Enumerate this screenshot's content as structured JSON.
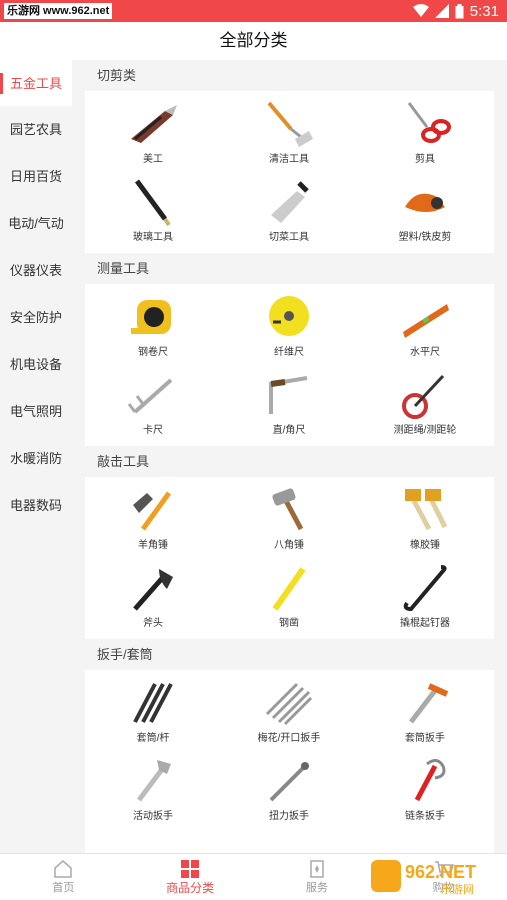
{
  "status": {
    "watermark_left": "乐游网 www.962.net",
    "time": "5:31"
  },
  "header": {
    "title": "全部分类"
  },
  "sidebar": {
    "items": [
      {
        "label": "五金工具",
        "active": true
      },
      {
        "label": "园艺农具"
      },
      {
        "label": "日用百货"
      },
      {
        "label": "电动/气动"
      },
      {
        "label": "仪器仪表"
      },
      {
        "label": "安全防护"
      },
      {
        "label": "机电设备"
      },
      {
        "label": "电气照明"
      },
      {
        "label": "水暖消防"
      },
      {
        "label": "电器数码"
      }
    ]
  },
  "sections": [
    {
      "title": "切剪类",
      "items": [
        {
          "label": "美工",
          "icon": "utility-knife-icon"
        },
        {
          "label": "清洁工具",
          "icon": "scraper-icon"
        },
        {
          "label": "剪具",
          "icon": "scissors-icon"
        },
        {
          "label": "玻璃工具",
          "icon": "glass-cutter-icon"
        },
        {
          "label": "切菜工具",
          "icon": "kitchen-knife-icon"
        },
        {
          "label": "塑料/铁皮剪",
          "icon": "pipe-cutter-icon"
        }
      ]
    },
    {
      "title": "测量工具",
      "items": [
        {
          "label": "钢卷尺",
          "icon": "tape-measure-icon"
        },
        {
          "label": "纤维尺",
          "icon": "fiber-tape-icon"
        },
        {
          "label": "水平尺",
          "icon": "spirit-level-icon"
        },
        {
          "label": "卡尺",
          "icon": "caliper-icon"
        },
        {
          "label": "直/角尺",
          "icon": "square-ruler-icon"
        },
        {
          "label": "测距绳/测距轮",
          "icon": "measuring-wheel-icon"
        }
      ]
    },
    {
      "title": "敲击工具",
      "items": [
        {
          "label": "羊角锤",
          "icon": "claw-hammer-icon"
        },
        {
          "label": "八角锤",
          "icon": "sledge-hammer-icon"
        },
        {
          "label": "橡胶锤",
          "icon": "rubber-mallet-icon"
        },
        {
          "label": "斧头",
          "icon": "axe-icon"
        },
        {
          "label": "钢凿",
          "icon": "chisel-icon"
        },
        {
          "label": "撬棍起钉器",
          "icon": "crowbar-icon"
        }
      ]
    },
    {
      "title": "扳手/套筒",
      "items": [
        {
          "label": "套筒/杆",
          "icon": "socket-bar-icon"
        },
        {
          "label": "梅花/开口扳手",
          "icon": "wrench-set-icon"
        },
        {
          "label": "套筒扳手",
          "icon": "socket-wrench-icon"
        },
        {
          "label": "活动扳手",
          "icon": "adjustable-wrench-icon"
        },
        {
          "label": "扭力扳手",
          "icon": "torque-wrench-icon"
        },
        {
          "label": "链条扳手",
          "icon": "chain-wrench-icon"
        },
        {
          "label": "",
          "icon": "partial-tool-icon"
        }
      ]
    }
  ],
  "bottom_nav": [
    {
      "label": "首页",
      "icon": "home-icon"
    },
    {
      "label": "商品分类",
      "icon": "category-icon",
      "active": true
    },
    {
      "label": "服务",
      "icon": "service-icon"
    },
    {
      "label": "购物",
      "icon": "cart-icon"
    }
  ],
  "watermark": {
    "text": "962.NET",
    "subtext": "乐游网"
  },
  "colors": {
    "accent": "#f04848",
    "background": "#f4f4f4"
  }
}
